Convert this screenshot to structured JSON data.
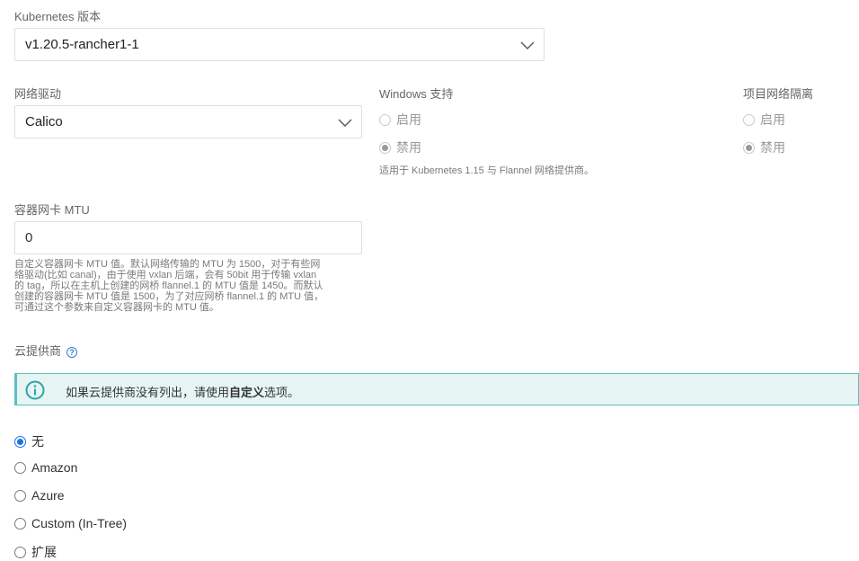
{
  "k8s": {
    "label": "Kubernetes 版本",
    "value": "v1.20.5-rancher1-1"
  },
  "network": {
    "label": "网络驱动",
    "value": "Calico"
  },
  "windows": {
    "label": "Windows 支持",
    "options": [
      "启用",
      "禁用"
    ],
    "selected": "禁用",
    "help": "适用于 Kubernetes 1.15 与 Flannel 网络提供商。"
  },
  "isolation": {
    "label": "项目网络隔离",
    "options": [
      "启用",
      "禁用"
    ],
    "selected": "禁用"
  },
  "mtu": {
    "label": "容器网卡 MTU",
    "value": "0",
    "help_lines": [
      "自定义容器网卡 MTU 值。默认网络传输的 MTU 为 1500，对于有些网",
      "络驱动(比如 canal)，由于使用 vxlan 后端，会有 50bit 用于传输 vxlan",
      "的 tag，所以在主机上创建的网桥 flannel.1 的 MTU 值是 1450。而默认",
      "创建的容器网卡 MTU 值是 1500，为了对应网桥 flannel.1 的 MTU 值，",
      "可通过这个参数来自定义容器网卡的 MTU 值。"
    ]
  },
  "cloud": {
    "label": "云提供商",
    "help_icon": "question-circle-icon",
    "banner": {
      "icon": "info-icon",
      "text_before": "如果云提供商没有列出，请使用",
      "text_bold": "自定义",
      "text_after": "选项。"
    },
    "options": [
      "无",
      "Amazon",
      "Azure",
      "Custom (In-Tree)",
      "扩展"
    ],
    "selected": "无"
  },
  "colors": {
    "accent": "#1a73e8",
    "banner_bg": "#e6f4f4",
    "banner_border": "#5dbfc0"
  }
}
